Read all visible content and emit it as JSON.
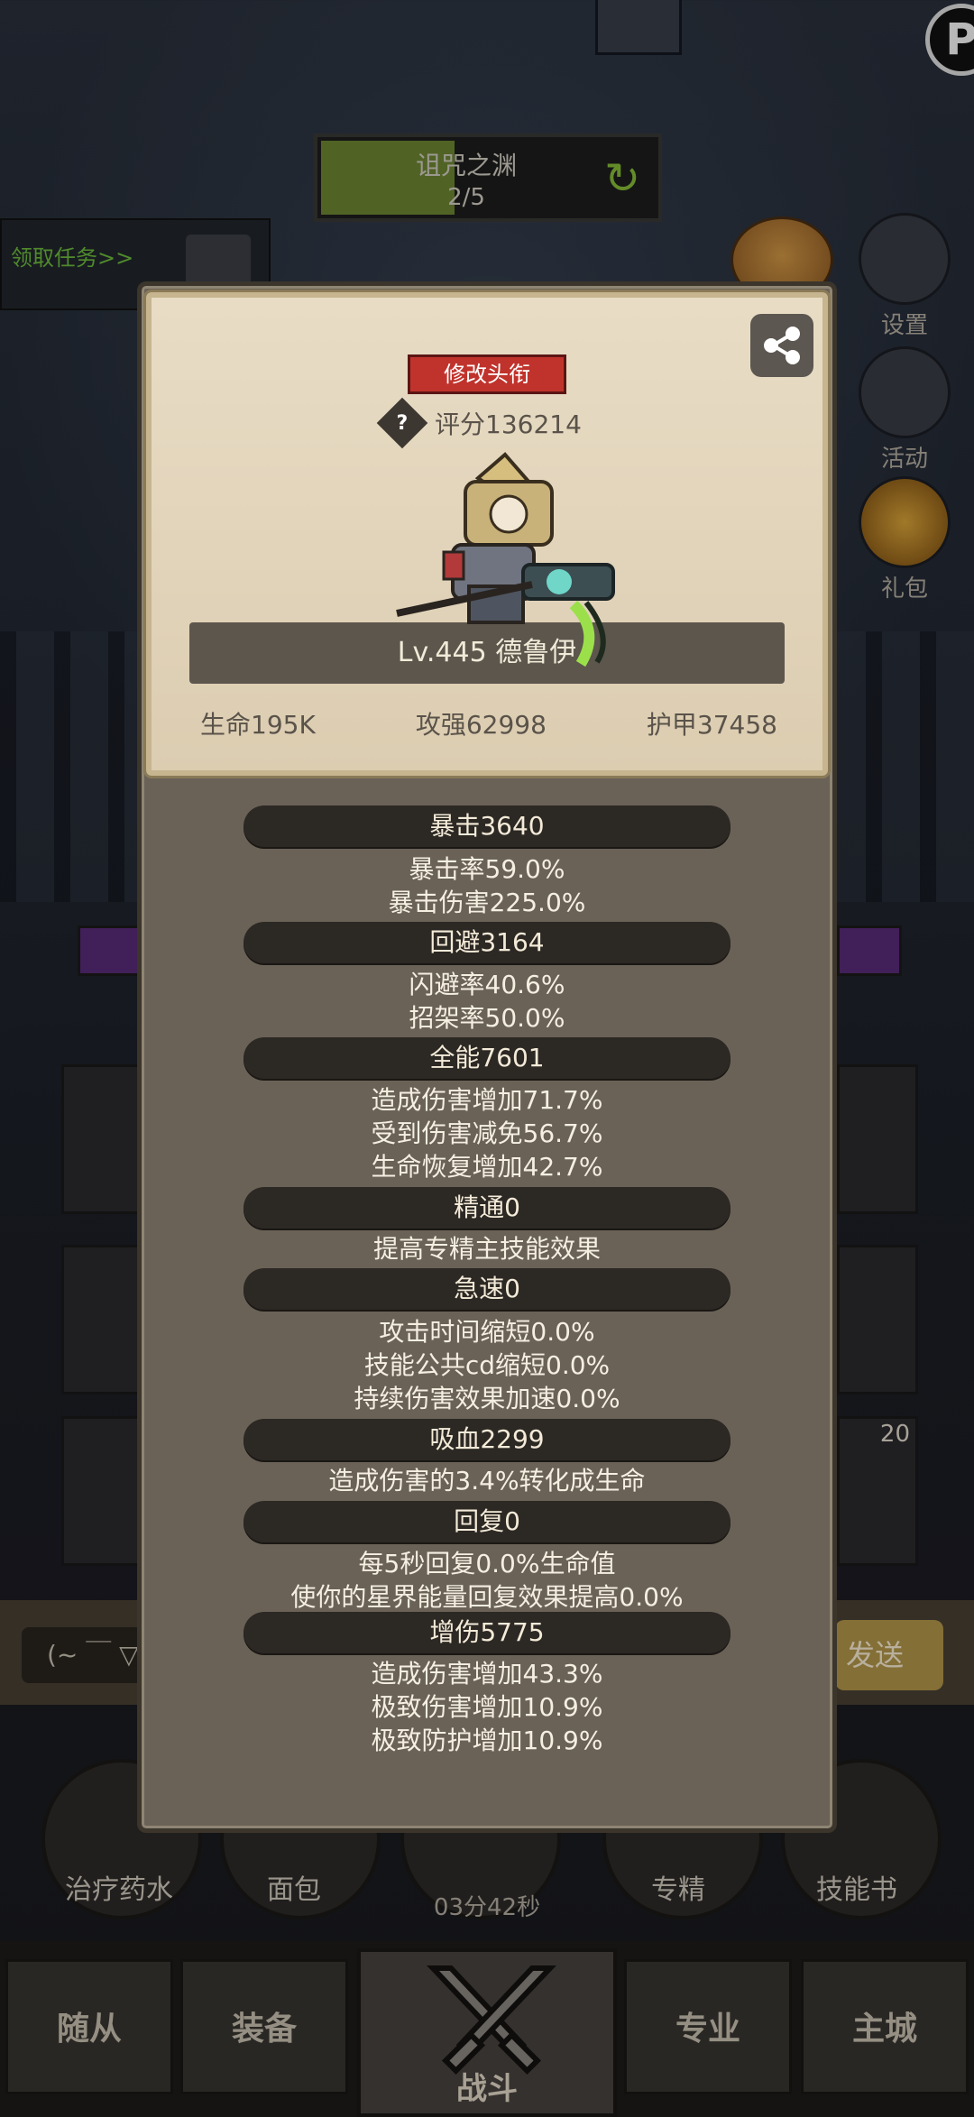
{
  "top": {
    "dungeon_name": "诅咒之渊",
    "dungeon_progress": "2/5",
    "progress_fraction": 0.4,
    "task_label": "领取任务>>",
    "badge_letter": "P"
  },
  "right_menu": [
    {
      "label": "设置",
      "icon": "gear-icon"
    },
    {
      "label": "活动",
      "icon": "activity-icon"
    },
    {
      "label": "礼包",
      "icon": "gift-icon"
    }
  ],
  "chat": {
    "input_text": "(~ ￣ ▽",
    "send_label": "发送"
  },
  "skills": [
    "治疗药水",
    "面包",
    "专精",
    "技能书"
  ],
  "timer": "03分42秒",
  "bottom_nav": [
    "随从",
    "装备",
    "战斗",
    "专业",
    "主城"
  ],
  "slot_badge": "20",
  "card": {
    "title_button": "修改头衔",
    "score": "评分136214",
    "level_name": "Lv.445 德鲁伊",
    "stats": [
      "生命195K",
      "攻强62998",
      "护甲37458"
    ]
  },
  "sections": [
    {
      "header": "暴击3640",
      "lines": [
        "暴击率59.0%",
        "暴击伤害225.0%"
      ]
    },
    {
      "header": "回避3164",
      "lines": [
        "闪避率40.6%",
        "招架率50.0%"
      ]
    },
    {
      "header": "全能7601",
      "lines": [
        "造成伤害增加71.7%",
        "受到伤害减免56.7%",
        "生命恢复增加42.7%"
      ]
    },
    {
      "header": "精通0",
      "lines": [
        "提高专精主技能效果"
      ]
    },
    {
      "header": "急速0",
      "lines": [
        "攻击时间缩短0.0%",
        "技能公共cd缩短0.0%",
        "持续伤害效果加速0.0%"
      ]
    },
    {
      "header": "吸血2299",
      "lines": [
        "造成伤害的3.4%转化成生命"
      ]
    },
    {
      "header": "回复0",
      "lines": [
        "每5秒回复0.0%生命值",
        "使你的星界能量回复效果提高0.0%"
      ]
    },
    {
      "header": "增伤5775",
      "lines": [
        "造成伤害增加43.3%",
        "极致伤害增加10.9%",
        "极致防护增加10.9%"
      ]
    }
  ]
}
